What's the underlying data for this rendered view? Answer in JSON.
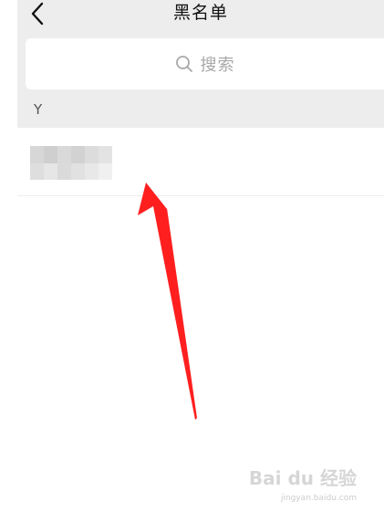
{
  "header": {
    "title": "黑名单",
    "back_icon": "chevron-left-icon"
  },
  "search": {
    "placeholder": "搜索",
    "icon": "search-icon"
  },
  "contacts": {
    "sections": [
      {
        "letter": "Y",
        "items": [
          {
            "name_redacted": true
          }
        ]
      }
    ]
  },
  "watermark": {
    "logo": "Bai du 经验",
    "url": "jingyan.baidu.com"
  },
  "colors": {
    "header_bg": "#ededed",
    "page_bg": "#ffffff",
    "title": "#111111",
    "placeholder": "#a8a8a8",
    "annotation_arrow": "#ff1f1f"
  }
}
